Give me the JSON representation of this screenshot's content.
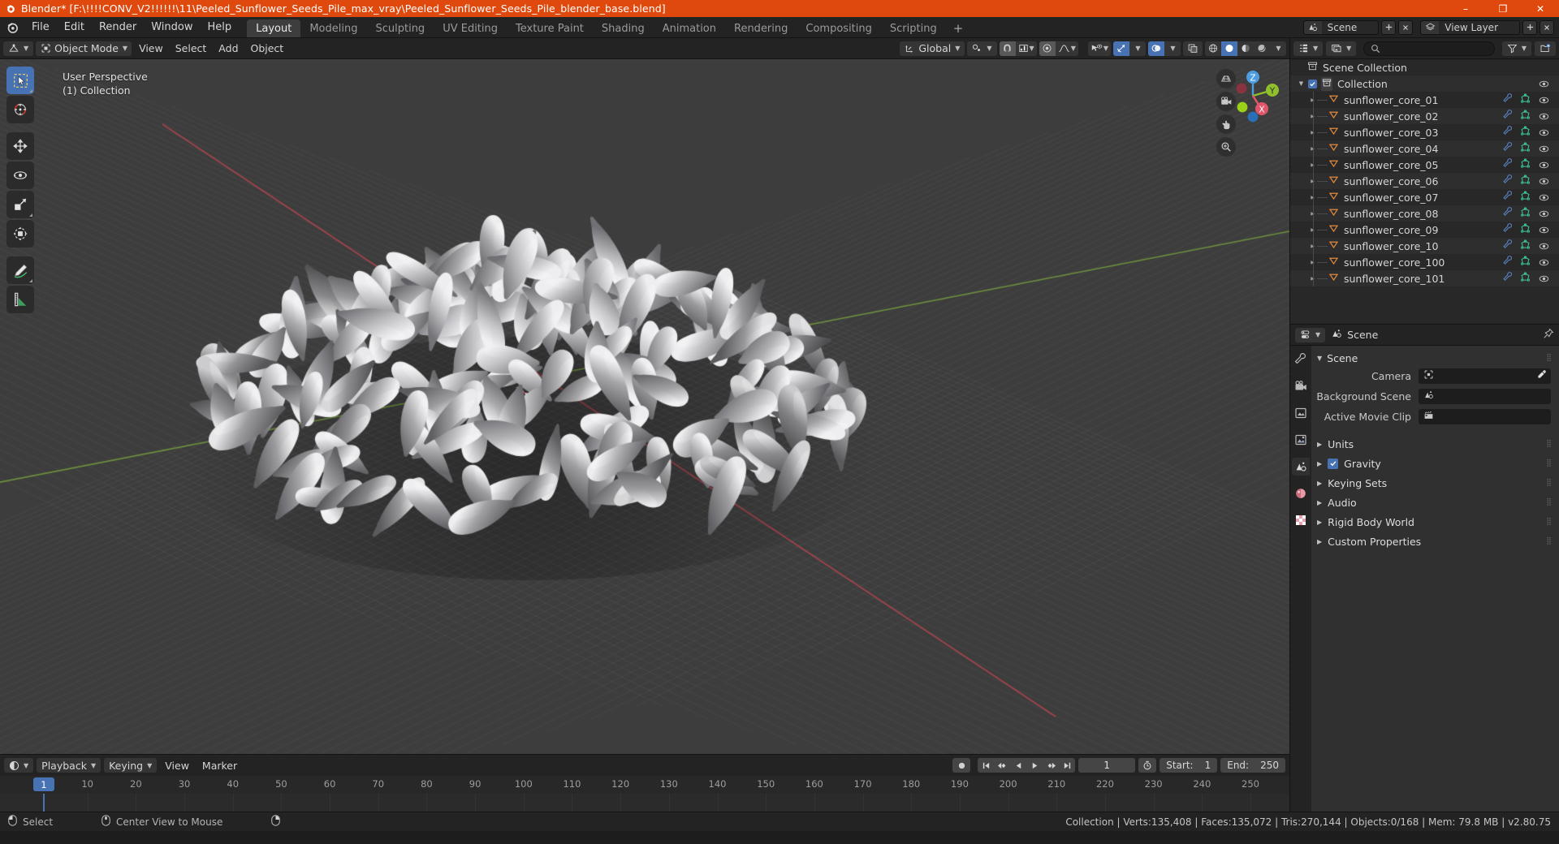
{
  "titlebar": {
    "text": "Blender* [F:\\!!!!CONV_V2!!!!!!\\11\\Peeled_Sunflower_Seeds_Pile_max_vray\\Peeled_Sunflower_Seeds_Pile_blender_base.blend]",
    "icon": "blender-logo-icon",
    "minimize": "–",
    "maximize": "❐",
    "close": "✕",
    "bg_color": "#e0490d"
  },
  "topbar": {
    "menus": [
      "File",
      "Edit",
      "Render",
      "Window",
      "Help"
    ],
    "workspaces": [
      {
        "label": "Layout",
        "active": true
      },
      {
        "label": "Modeling",
        "active": false
      },
      {
        "label": "Sculpting",
        "active": false
      },
      {
        "label": "UV Editing",
        "active": false
      },
      {
        "label": "Texture Paint",
        "active": false
      },
      {
        "label": "Shading",
        "active": false
      },
      {
        "label": "Animation",
        "active": false
      },
      {
        "label": "Rendering",
        "active": false
      },
      {
        "label": "Compositing",
        "active": false
      },
      {
        "label": "Scripting",
        "active": false
      }
    ],
    "add_workspace": "+",
    "scene_name": "Scene",
    "view_layer_name": "View Layer"
  },
  "viewport_header": {
    "editor_type": "editor-type-3dview",
    "mode": "Object Mode",
    "menus": [
      "View",
      "Select",
      "Add",
      "Object"
    ],
    "transform_orientation": "Global",
    "snap_icon": "magnet-icon",
    "proportional_icon": "proportional-edit-icon",
    "shading_modes": [
      "wireframe",
      "solid",
      "material-preview",
      "rendered"
    ],
    "active_shading": "solid"
  },
  "viewport": {
    "perspective_label": "User Perspective",
    "collection_label": "(1) Collection",
    "gizmo_axes": [
      "X",
      "Y",
      "Z"
    ],
    "bg_color": "#3d3d3d",
    "tools": [
      {
        "name": "tweak-select-box-tool",
        "active": true
      },
      {
        "name": "cursor-tool",
        "active": false
      },
      {
        "name": "move-tool",
        "active": false
      },
      {
        "name": "rotate-tool",
        "active": false
      },
      {
        "name": "scale-tool",
        "active": false
      },
      {
        "name": "transform-tool",
        "active": false
      },
      {
        "name": "annotate-tool",
        "active": false
      },
      {
        "name": "measure-tool",
        "active": false
      }
    ],
    "nav_buttons": [
      "zoom-region-icon",
      "camera-view-icon",
      "pan-view-icon",
      "zoom-view-icon"
    ]
  },
  "timeline": {
    "editor_icon": "timeline-editor-icon",
    "menus": [
      "Playback",
      "Keying",
      "View",
      "Marker"
    ],
    "current_frame": "1",
    "start_label": "Start:",
    "start_value": "1",
    "end_label": "End:",
    "end_value": "250",
    "ticks": [
      10,
      20,
      30,
      40,
      50,
      60,
      70,
      80,
      90,
      100,
      110,
      120,
      130,
      140,
      150,
      160,
      170,
      180,
      190,
      200,
      210,
      220,
      230,
      240,
      250
    ],
    "playhead_label": "1"
  },
  "outliner": {
    "display_mode_icon": "outliner-display-mode-icon",
    "filter_icon": "filter-icon",
    "new_collection_icon": "new-collection-icon",
    "search_placeholder": "",
    "scene_collection": "Scene Collection",
    "collection": "Collection",
    "objects": [
      "sunflower_core_01",
      "sunflower_core_02",
      "sunflower_core_03",
      "sunflower_core_04",
      "sunflower_core_05",
      "sunflower_core_06",
      "sunflower_core_07",
      "sunflower_core_08",
      "sunflower_core_09",
      "sunflower_core_10",
      "sunflower_core_100",
      "sunflower_core_101"
    ]
  },
  "properties": {
    "breadcrumb_icon": "scene-properties-icon",
    "breadcrumb": "Scene",
    "pin_icon": "pin-icon",
    "tabs": [
      {
        "name": "tool-tab",
        "active": false
      },
      {
        "name": "render-tab",
        "active": false
      },
      {
        "name": "output-tab",
        "active": false
      },
      {
        "name": "view-layer-tab",
        "active": false
      },
      {
        "name": "scene-tab",
        "active": true
      },
      {
        "name": "world-tab",
        "active": false
      },
      {
        "name": "texture-tab",
        "active": false
      }
    ],
    "scene_panel_title": "Scene",
    "fields": [
      {
        "label": "Camera",
        "value": "",
        "icon": "camera-data-icon"
      },
      {
        "label": "Background Scene",
        "value": "",
        "icon": "scene-data-icon"
      },
      {
        "label": "Active Movie Clip",
        "value": "",
        "icon": "movie-clip-icon"
      }
    ],
    "panels": [
      {
        "label": "Units",
        "checkbox": false
      },
      {
        "label": "Gravity",
        "checkbox": true
      },
      {
        "label": "Keying Sets",
        "checkbox": false
      },
      {
        "label": "Audio",
        "checkbox": false
      },
      {
        "label": "Rigid Body World",
        "checkbox": false
      },
      {
        "label": "Custom Properties",
        "checkbox": false
      }
    ]
  },
  "statusbar": {
    "keymap": [
      {
        "icon": "mouse-left-icon",
        "label": "Select"
      },
      {
        "icon": "mouse-middle-icon",
        "label": "Center View to Mouse"
      },
      {
        "icon": "mouse-right-icon",
        "label": ""
      }
    ],
    "stats": "Collection | Verts:135,408 | Faces:135,072 | Tris:270,144 | Objects:0/168 | Mem: 79.8 MB | v2.80.75"
  }
}
